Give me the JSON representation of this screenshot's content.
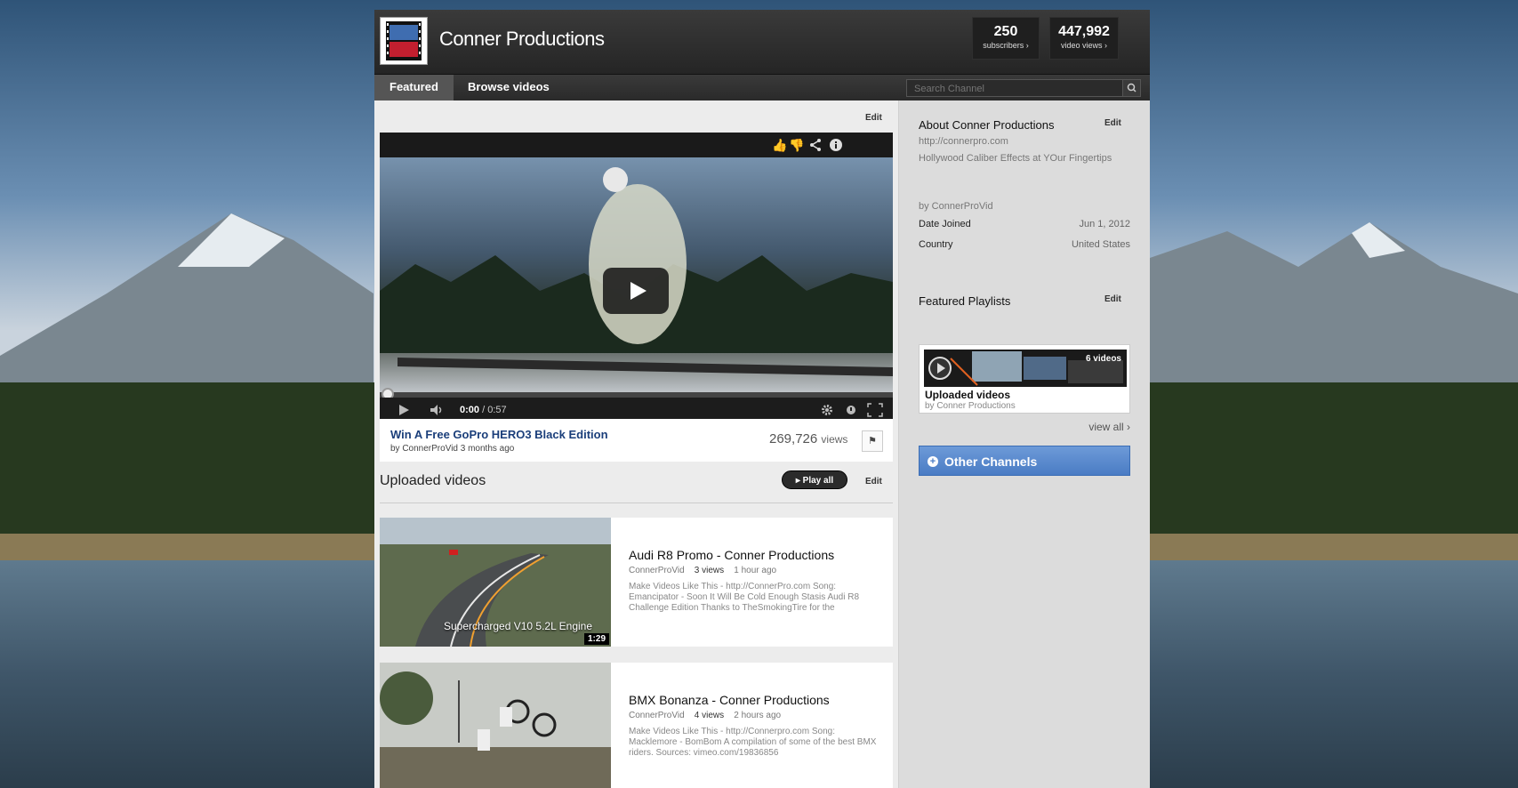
{
  "header": {
    "channel_name": "Conner Productions",
    "stats": [
      {
        "value": "250",
        "label": "subscribers ›"
      },
      {
        "value": "447,992",
        "label": "video views ›"
      }
    ]
  },
  "nav": {
    "tabs": [
      {
        "label": "Featured",
        "active": true
      },
      {
        "label": "Browse videos",
        "active": false
      }
    ],
    "search_placeholder": "Search Channel"
  },
  "featured": {
    "edit_label": "Edit",
    "time_current": "0:00",
    "time_total": "/ 0:57",
    "title": "Win A Free GoPro HERO3 Black Edition",
    "meta": "by ConnerProVid 3 months ago",
    "views_count": "269,726",
    "views_label": "views"
  },
  "uploaded": {
    "title": "Uploaded videos",
    "play_all_label": "Play all",
    "edit_label": "Edit",
    "videos": [
      {
        "title": "Audi R8 Promo - Conner Productions",
        "channel": "ConnerProVid",
        "views": "3 views",
        "age": "1 hour ago",
        "description": "Make Videos Like This - http://ConnerPro.com Song: Emancipator - Soon It Will Be Cold Enough Stasis Audi R8 Challenge Edition Thanks to TheSmokingTire for the",
        "thumb_caption": "Supercharged V10 5.2L Engine",
        "duration": "1:29"
      },
      {
        "title": "BMX Bonanza - Conner Productions",
        "channel": "ConnerProVid",
        "views": "4 views",
        "age": "2 hours ago",
        "description": "Make Videos Like This - http://Connerpro.com Song: Macklemore - BomBom A compilation of some of the best BMX riders. Sources: vimeo.com/19836856",
        "thumb_caption": "",
        "duration": ""
      }
    ]
  },
  "sidebar": {
    "about_title": "About Conner Productions",
    "about_edit": "Edit",
    "url": "http://connerpro.com",
    "tagline": "Hollywood Caliber Effects at YOur Fingertips",
    "by": "by ConnerProVid",
    "date_joined_label": "Date Joined",
    "date_joined_value": "Jun 1, 2012",
    "country_label": "Country",
    "country_value": "United States",
    "playlists_title": "Featured Playlists",
    "playlists_edit": "Edit",
    "playlist": {
      "count": "6 videos",
      "title": "Uploaded videos",
      "by": "by Conner Productions"
    },
    "view_all": "view all ›",
    "other_channels": "Other Channels"
  },
  "colors": {
    "accent": "#4a7cc4",
    "link": "#1a3e7a",
    "header_bg": "#2a2a2a"
  }
}
